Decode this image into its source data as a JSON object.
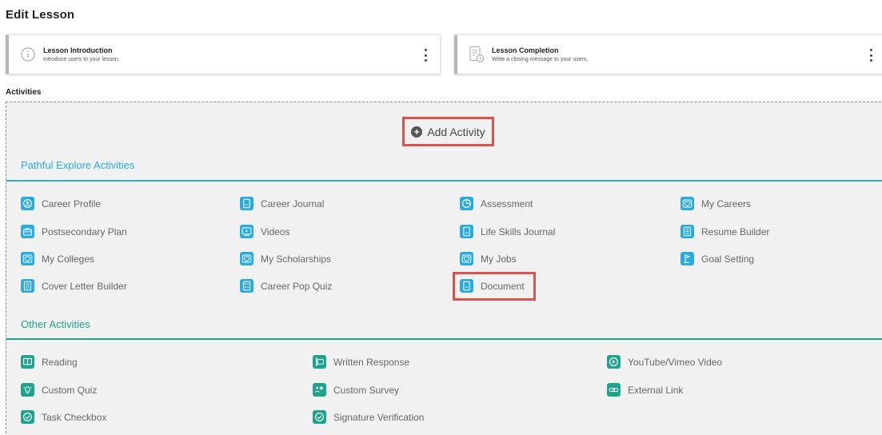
{
  "page_title": "Edit Lesson",
  "cards": [
    {
      "title": "Lesson Introduction",
      "subtitle": "Introduce users to your lesson."
    },
    {
      "title": "Lesson Completion",
      "subtitle": "Write a closing message to your users."
    }
  ],
  "activities_label": "Activities",
  "add_activity_label": "Add Activity",
  "colors": {
    "explore_accent": "#29aae1",
    "other_accent": "#1fa38d",
    "highlight": "#d9534f"
  },
  "explore": {
    "heading": "Pathful Explore Activities",
    "items": [
      {
        "label": "Career Profile",
        "icon": "person-badge-icon"
      },
      {
        "label": "Career Journal",
        "icon": "journal-icon"
      },
      {
        "label": "Assessment",
        "icon": "pie-chart-icon"
      },
      {
        "label": "My Careers",
        "icon": "heart-icon"
      },
      {
        "label": "Postsecondary Plan",
        "icon": "briefcase-icon"
      },
      {
        "label": "Videos",
        "icon": "video-icon"
      },
      {
        "label": "Life Skills Journal",
        "icon": "journal-icon"
      },
      {
        "label": "Resume Builder",
        "icon": "document-icon"
      },
      {
        "label": "My Colleges",
        "icon": "heart-icon"
      },
      {
        "label": "My Scholarships",
        "icon": "heart-icon"
      },
      {
        "label": "My Jobs",
        "icon": "heart-icon"
      },
      {
        "label": "Goal Setting",
        "icon": "flag-icon"
      },
      {
        "label": "Cover Letter Builder",
        "icon": "document-icon"
      },
      {
        "label": "Career Pop Quiz",
        "icon": "quiz-icon"
      },
      {
        "label": "Document",
        "icon": "journal-icon"
      }
    ]
  },
  "other": {
    "heading": "Other Activities",
    "items": [
      {
        "label": "Reading",
        "icon": "book-icon"
      },
      {
        "label": "Written Response",
        "icon": "text-cursor-icon"
      },
      {
        "label": "YouTube/Vimeo Video",
        "icon": "play-icon"
      },
      {
        "label": "Custom Quiz",
        "icon": "lightbulb-icon"
      },
      {
        "label": "Custom Survey",
        "icon": "survey-icon"
      },
      {
        "label": "External Link",
        "icon": "link-icon"
      },
      {
        "label": "Task Checkbox",
        "icon": "check-circle-icon"
      },
      {
        "label": "Signature Verification",
        "icon": "check-circle-icon"
      }
    ]
  }
}
